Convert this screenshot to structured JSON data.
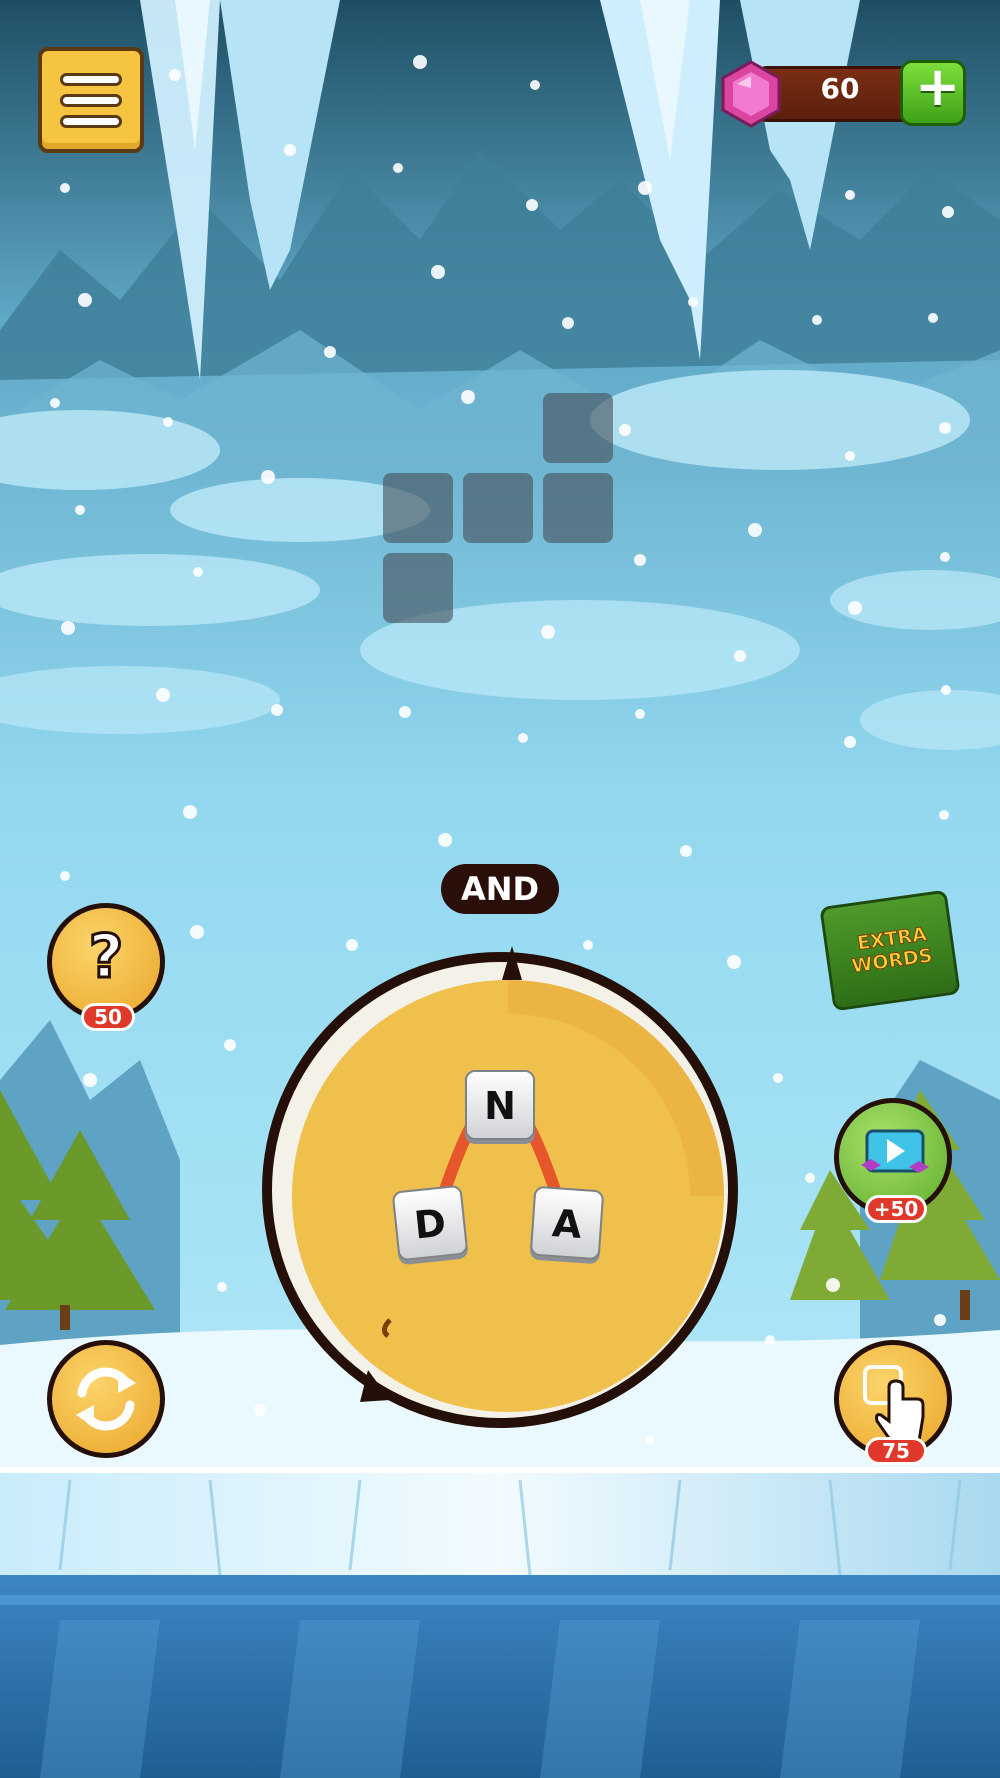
{
  "hud": {
    "gem_count": "60",
    "icons": {
      "menu": "menu-icon",
      "gem": "gem-icon",
      "add": "plus-icon"
    }
  },
  "board": {
    "empty_cells": 5
  },
  "current_word": "AND",
  "wheel": {
    "letters": [
      "N",
      "D",
      "A"
    ]
  },
  "side_buttons": {
    "hint": {
      "icon": "question-mark-icon",
      "cost": "50"
    },
    "shuffle": {
      "icon": "shuffle-icon"
    },
    "extra_words": {
      "line1": "EXTRA",
      "line2": "WORDS"
    },
    "video_reward": {
      "icon": "play-video-icon",
      "reward": "+50"
    },
    "pick_letter": {
      "icon": "tap-finger-icon",
      "cost": "75"
    }
  },
  "colors": {
    "sky_top": "#1e4e64",
    "sky_mid": "#8fd6f0",
    "ice": "#4aa3dc",
    "wheel": "#f0c04d",
    "drag_line": "#e5562a",
    "badge": "#e0392b"
  }
}
